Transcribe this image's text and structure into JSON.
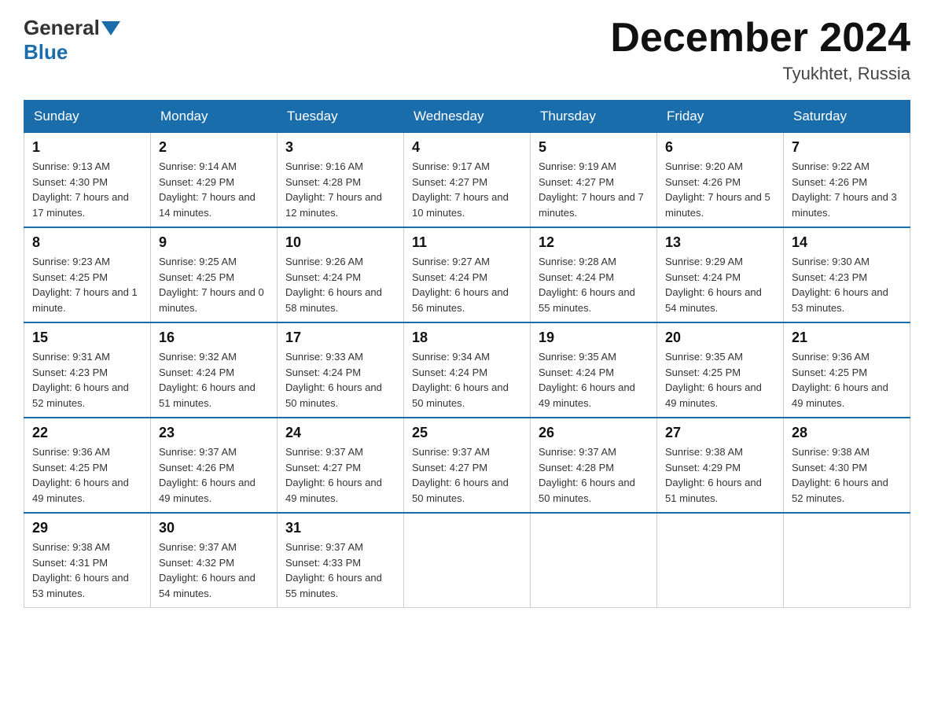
{
  "header": {
    "logo_general": "General",
    "logo_blue": "Blue",
    "month_year": "December 2024",
    "location": "Tyukhtet, Russia"
  },
  "days_of_week": [
    "Sunday",
    "Monday",
    "Tuesday",
    "Wednesday",
    "Thursday",
    "Friday",
    "Saturday"
  ],
  "weeks": [
    [
      {
        "day": "1",
        "sunrise": "9:13 AM",
        "sunset": "4:30 PM",
        "daylight": "7 hours and 17 minutes."
      },
      {
        "day": "2",
        "sunrise": "9:14 AM",
        "sunset": "4:29 PM",
        "daylight": "7 hours and 14 minutes."
      },
      {
        "day": "3",
        "sunrise": "9:16 AM",
        "sunset": "4:28 PM",
        "daylight": "7 hours and 12 minutes."
      },
      {
        "day": "4",
        "sunrise": "9:17 AM",
        "sunset": "4:27 PM",
        "daylight": "7 hours and 10 minutes."
      },
      {
        "day": "5",
        "sunrise": "9:19 AM",
        "sunset": "4:27 PM",
        "daylight": "7 hours and 7 minutes."
      },
      {
        "day": "6",
        "sunrise": "9:20 AM",
        "sunset": "4:26 PM",
        "daylight": "7 hours and 5 minutes."
      },
      {
        "day": "7",
        "sunrise": "9:22 AM",
        "sunset": "4:26 PM",
        "daylight": "7 hours and 3 minutes."
      }
    ],
    [
      {
        "day": "8",
        "sunrise": "9:23 AM",
        "sunset": "4:25 PM",
        "daylight": "7 hours and 1 minute."
      },
      {
        "day": "9",
        "sunrise": "9:25 AM",
        "sunset": "4:25 PM",
        "daylight": "7 hours and 0 minutes."
      },
      {
        "day": "10",
        "sunrise": "9:26 AM",
        "sunset": "4:24 PM",
        "daylight": "6 hours and 58 minutes."
      },
      {
        "day": "11",
        "sunrise": "9:27 AM",
        "sunset": "4:24 PM",
        "daylight": "6 hours and 56 minutes."
      },
      {
        "day": "12",
        "sunrise": "9:28 AM",
        "sunset": "4:24 PM",
        "daylight": "6 hours and 55 minutes."
      },
      {
        "day": "13",
        "sunrise": "9:29 AM",
        "sunset": "4:24 PM",
        "daylight": "6 hours and 54 minutes."
      },
      {
        "day": "14",
        "sunrise": "9:30 AM",
        "sunset": "4:23 PM",
        "daylight": "6 hours and 53 minutes."
      }
    ],
    [
      {
        "day": "15",
        "sunrise": "9:31 AM",
        "sunset": "4:23 PM",
        "daylight": "6 hours and 52 minutes."
      },
      {
        "day": "16",
        "sunrise": "9:32 AM",
        "sunset": "4:24 PM",
        "daylight": "6 hours and 51 minutes."
      },
      {
        "day": "17",
        "sunrise": "9:33 AM",
        "sunset": "4:24 PM",
        "daylight": "6 hours and 50 minutes."
      },
      {
        "day": "18",
        "sunrise": "9:34 AM",
        "sunset": "4:24 PM",
        "daylight": "6 hours and 50 minutes."
      },
      {
        "day": "19",
        "sunrise": "9:35 AM",
        "sunset": "4:24 PM",
        "daylight": "6 hours and 49 minutes."
      },
      {
        "day": "20",
        "sunrise": "9:35 AM",
        "sunset": "4:25 PM",
        "daylight": "6 hours and 49 minutes."
      },
      {
        "day": "21",
        "sunrise": "9:36 AM",
        "sunset": "4:25 PM",
        "daylight": "6 hours and 49 minutes."
      }
    ],
    [
      {
        "day": "22",
        "sunrise": "9:36 AM",
        "sunset": "4:25 PM",
        "daylight": "6 hours and 49 minutes."
      },
      {
        "day": "23",
        "sunrise": "9:37 AM",
        "sunset": "4:26 PM",
        "daylight": "6 hours and 49 minutes."
      },
      {
        "day": "24",
        "sunrise": "9:37 AM",
        "sunset": "4:27 PM",
        "daylight": "6 hours and 49 minutes."
      },
      {
        "day": "25",
        "sunrise": "9:37 AM",
        "sunset": "4:27 PM",
        "daylight": "6 hours and 50 minutes."
      },
      {
        "day": "26",
        "sunrise": "9:37 AM",
        "sunset": "4:28 PM",
        "daylight": "6 hours and 50 minutes."
      },
      {
        "day": "27",
        "sunrise": "9:38 AM",
        "sunset": "4:29 PM",
        "daylight": "6 hours and 51 minutes."
      },
      {
        "day": "28",
        "sunrise": "9:38 AM",
        "sunset": "4:30 PM",
        "daylight": "6 hours and 52 minutes."
      }
    ],
    [
      {
        "day": "29",
        "sunrise": "9:38 AM",
        "sunset": "4:31 PM",
        "daylight": "6 hours and 53 minutes."
      },
      {
        "day": "30",
        "sunrise": "9:37 AM",
        "sunset": "4:32 PM",
        "daylight": "6 hours and 54 minutes."
      },
      {
        "day": "31",
        "sunrise": "9:37 AM",
        "sunset": "4:33 PM",
        "daylight": "6 hours and 55 minutes."
      },
      null,
      null,
      null,
      null
    ]
  ]
}
